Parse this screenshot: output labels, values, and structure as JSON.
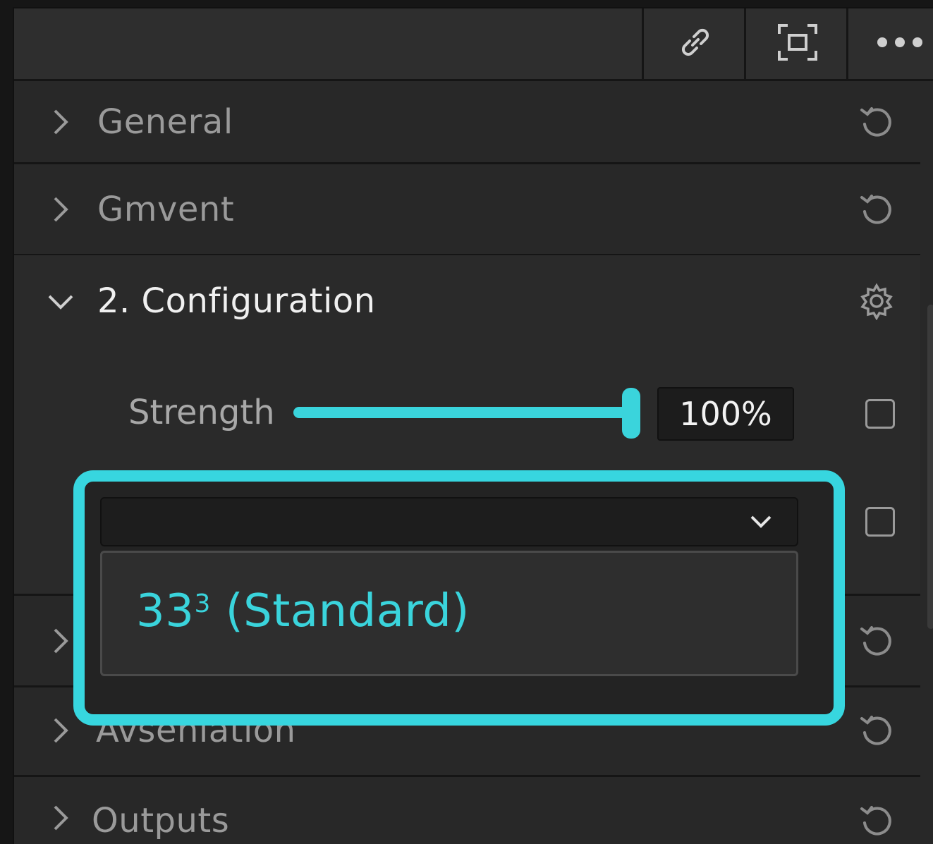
{
  "toolbar": {
    "buttons": [
      {
        "icon": "link-icon"
      },
      {
        "icon": "frame-icon"
      },
      {
        "icon": "more-icon"
      }
    ]
  },
  "sections": {
    "general": {
      "label": "General",
      "expanded": false
    },
    "gmvent": {
      "label": "Gmvent",
      "expanded": false
    },
    "configuration": {
      "label": "2. Configuration",
      "expanded": true
    },
    "hidden": {
      "label": "",
      "expanded": false
    },
    "avseniation": {
      "label": "Avseniation",
      "expanded": false
    },
    "outputs": {
      "label": "Outputs",
      "expanded": false
    }
  },
  "configuration": {
    "strength": {
      "label": "Strength",
      "value_text": "100%",
      "value_fraction": 1.0
    },
    "dropdown": {
      "selected_value": "",
      "options": [
        {
          "main": "33",
          "sup": "3",
          "suffix": " (Standard)"
        }
      ]
    }
  },
  "colors": {
    "accent": "#3ad4dc",
    "panel_bg": "#282828",
    "text_muted": "#9a9a9a",
    "text_bright": "#f0f0f0"
  }
}
